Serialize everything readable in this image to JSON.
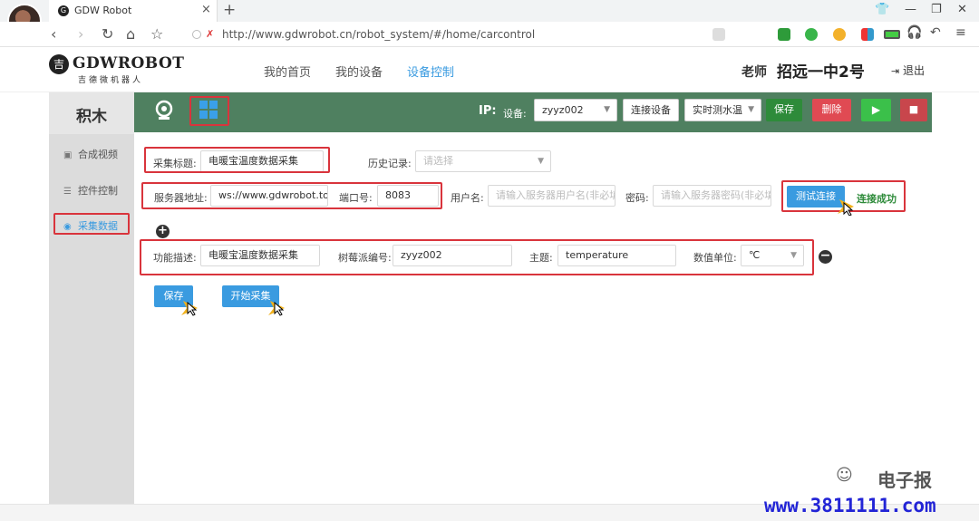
{
  "browser": {
    "tab_title": "GDW Robot",
    "tab_close": "×",
    "new_tab": "+",
    "url": "http://www.gdwrobot.cn/robot_system/#/home/carcontrol"
  },
  "header": {
    "logo_mark": "吉",
    "logo_text": "GDWROBOT",
    "logo_sub": "吉德微机器人",
    "nav": [
      "我的首页",
      "我的设备",
      "设备控制"
    ],
    "teacher": "老师",
    "school": "招远一中2号",
    "logout": "退出"
  },
  "sidebar": {
    "title": "积木",
    "items": [
      "合成视频",
      "控件控制",
      "采集数据"
    ]
  },
  "toolbar": {
    "ip_label": "IP:",
    "device_label": "设备:",
    "device_value": "zyyz002",
    "connect_label": "连接设备",
    "mode_value": "实时测水温",
    "save_label": "保存",
    "delete_label": "删除"
  },
  "form": {
    "collect_title_label": "采集标题:",
    "collect_title_value": "电暖宝温度数据采集",
    "history_label": "历史记录:",
    "history_placeholder": "请选择",
    "server_label": "服务器地址:",
    "server_value": "ws://www.gdwrobot.top",
    "port_label": "端口号:",
    "port_value": "8083",
    "username_label": "用户名:",
    "username_placeholder": "请输入服务器用户名(非必填)",
    "password_label": "密码:",
    "password_placeholder": "请输入服务器密码(非必填)",
    "test_button": "测试连接",
    "success_text": "连接成功",
    "func_label": "功能描述:",
    "func_value": "电暖宝温度数据采集",
    "pi_label": "树莓派编号:",
    "pi_value": "zyyz002",
    "topic_label": "主题:",
    "topic_value": "temperature",
    "unit_label": "数值单位:",
    "unit_value": "℃",
    "save_button": "保存",
    "start_button": "开始采集"
  },
  "watermark": {
    "brand": "电子报",
    "url": "www.3811111.com"
  }
}
